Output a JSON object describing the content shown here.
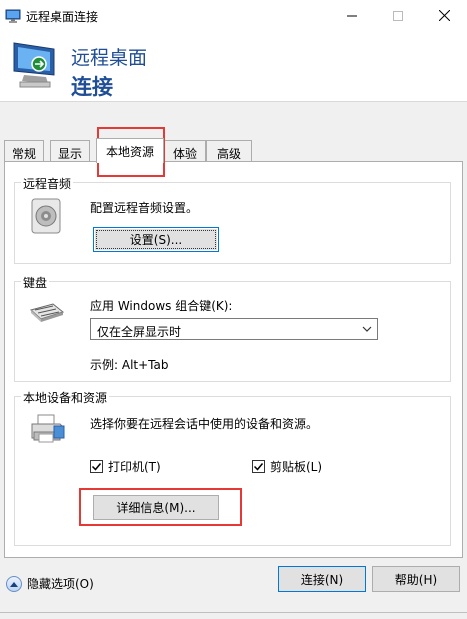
{
  "window": {
    "title": "远程桌面连接"
  },
  "header": {
    "line1": "远程桌面",
    "line2": "连接"
  },
  "tabs": [
    {
      "label": "常规"
    },
    {
      "label": "显示"
    },
    {
      "label": "本地资源"
    },
    {
      "label": "体验"
    },
    {
      "label": "高级"
    }
  ],
  "audio": {
    "group_label": "远程音频",
    "description": "配置远程音频设置。",
    "settings_button": "设置(S)..."
  },
  "keyboard": {
    "group_label": "键盘",
    "description": "应用 Windows 组合键(K):",
    "select_value": "仅在全屏显示时",
    "example": "示例: Alt+Tab"
  },
  "local_devices": {
    "group_label": "本地设备和资源",
    "description": "选择你要在远程会话中使用的设备和资源。",
    "printer_label": "打印机(T)",
    "clipboard_label": "剪贴板(L)",
    "printer_checked": true,
    "clipboard_checked": true,
    "details_button": "详细信息(M)..."
  },
  "footer": {
    "hide_options": "隐藏选项(O)",
    "connect_button": "连接(N)",
    "help_button": "帮助(H)"
  }
}
